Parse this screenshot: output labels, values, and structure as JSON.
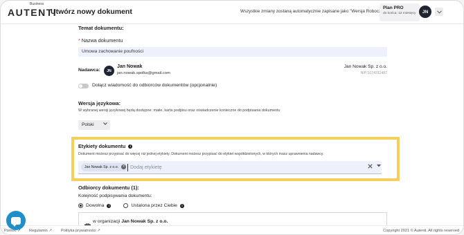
{
  "header": {
    "logo_small": "Business",
    "logo_word": "AUTENTI",
    "title": "Utwórz nowy dokument",
    "autosave_text": "Wszystkie zmiany zostaną automatycznie zapisane jako \"Wersja Robocza\"",
    "plan_name": "Plan PRO",
    "plan_sub": "do końca: 12 miesięcy",
    "avatar_initials": "JN",
    "menu_caret": "⌄"
  },
  "document_topic": {
    "section_title": "Temat dokumentu:",
    "name_required_mark": "*",
    "name_label": "Nazwa dokumentu",
    "name_value": "Umowa zachowanie poufności"
  },
  "sender": {
    "label": "Nadawca:",
    "avatar_initials": "JN",
    "name": "Jan Nowak",
    "email": "jan.nowak.spolka@gmail.com",
    "company": "Jan Nowak Sp. z o.o.",
    "nip": "NIP:1074311487"
  },
  "message_toggle": {
    "label": "Dołącz wiadomość do odbiorców dokumentów (opcjonalnie)"
  },
  "language": {
    "section_title": "Wersja językowa:",
    "description": "W wybranej wersji językowej będą dostępne: maile, karta podpisu oraz oświadczenie konieczne do podpisania dokumentu",
    "selected": "Polski"
  },
  "labels": {
    "section_title": "Etykiety dokumentu",
    "description": "Dokument możesz przypisać do więcej niż jednej etykiety. Dokument możesz przypisać do etykiet współdzielonych, w których masz uprawnienia nadawcy.",
    "chip": "Jan Nowak Sp. z o.o.",
    "placeholder": "Dodaj etykietę"
  },
  "recipients": {
    "section_title": "Odbiorcy dokumentu (1):",
    "order_label": "Kolejność podpisywania dokumentu:",
    "option_any": "Dowolna",
    "option_fixed": "Ustalona przez Ciebie",
    "org_prefix": "w organizacji",
    "org_name": "Jan Nowak Sp. z o.o."
  },
  "footer": {
    "link_help": "Pomoc",
    "link_terms": "Regulamin",
    "link_privacy": "Polityka prywatności",
    "copyright": "Copyright 2021 © Autenti. All rights reserved"
  },
  "colors": {
    "highlight_border": "#f6cf5a",
    "input_bg": "#eef1fb",
    "fab": "#1f8ec9",
    "avatar": "#1f2433"
  }
}
